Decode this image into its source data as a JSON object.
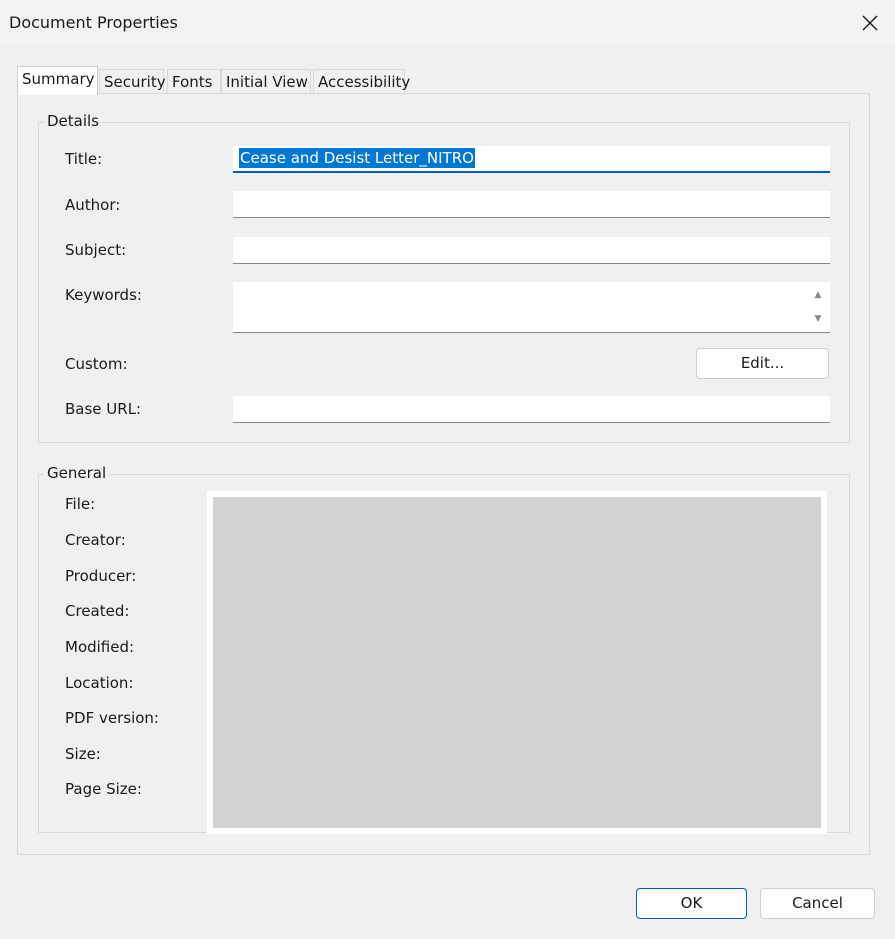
{
  "window": {
    "title": "Document Properties"
  },
  "tabs": [
    {
      "label": "Summary",
      "active": true
    },
    {
      "label": "Security"
    },
    {
      "label": "Fonts"
    },
    {
      "label": "Initial View"
    },
    {
      "label": "Accessibility"
    }
  ],
  "details": {
    "legend": "Details",
    "title_label": "Title:",
    "title_value": "Cease and Desist Letter_NITRO",
    "author_label": "Author:",
    "author_value": "",
    "subject_label": "Subject:",
    "subject_value": "",
    "keywords_label": "Keywords:",
    "keywords_value": "",
    "custom_label": "Custom:",
    "edit_button": "Edit...",
    "base_url_label": "Base URL:",
    "base_url_value": ""
  },
  "general": {
    "legend": "General",
    "labels": [
      "File:",
      "Creator:",
      "Producer:",
      "Created:",
      "Modified:",
      "Location:",
      "PDF version:",
      "Size:",
      "Page Size:"
    ]
  },
  "footer": {
    "ok": "OK",
    "cancel": "Cancel"
  },
  "colors": {
    "accent": "#005fb8",
    "selection": "#0078d4",
    "redacted": "#d1d2d4"
  }
}
